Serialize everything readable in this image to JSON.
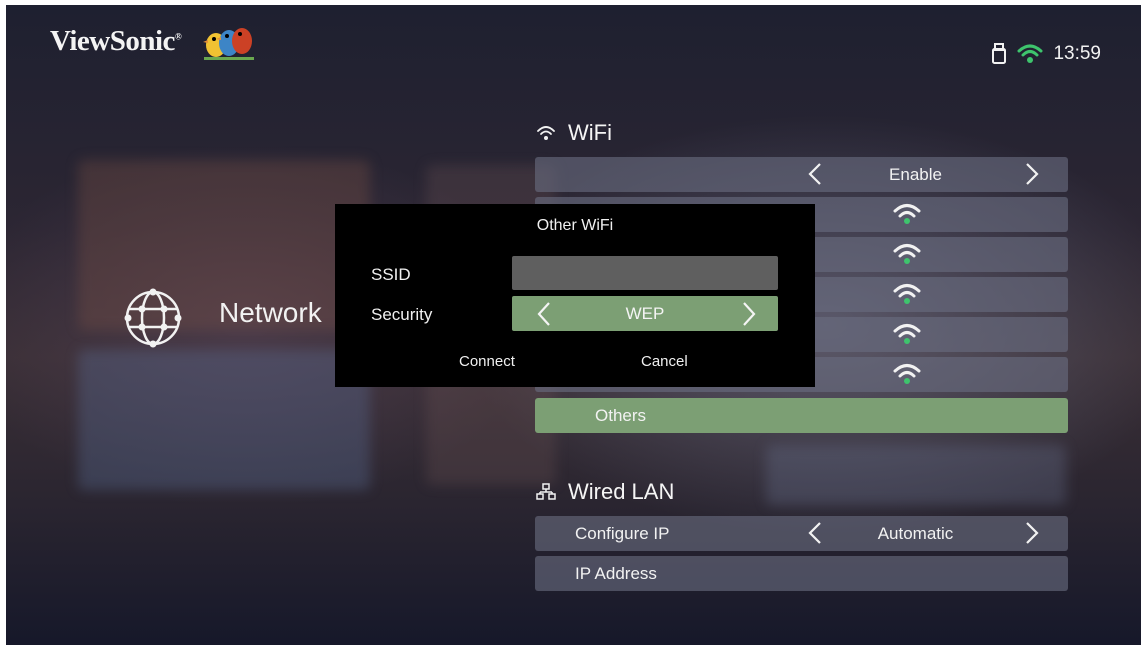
{
  "header": {
    "brand": "ViewSonic",
    "brand_mark": "®",
    "time": "13:59",
    "icons": [
      "usb-icon",
      "wifi-connected-icon"
    ]
  },
  "category": {
    "label": "Network",
    "icon": "globe-icon"
  },
  "wifi": {
    "title": "WiFi",
    "status_value": "Enable",
    "networks_count_visible": 5,
    "others_label": "Others"
  },
  "wired": {
    "title": "Wired LAN",
    "configure_ip_label": "Configure IP",
    "configure_ip_value": "Automatic",
    "ip_address_label": "IP Address"
  },
  "dialog": {
    "title": "Other WiFi",
    "ssid_label": "SSID",
    "ssid_value": "",
    "security_label": "Security",
    "security_value": "WEP",
    "connect_label": "Connect",
    "cancel_label": "Cancel"
  },
  "colors": {
    "accent_green": "#7c9f74",
    "wifi_dot_green": "#3ec46d",
    "row_bg": "#696c80",
    "dialog_bg": "#000000"
  }
}
